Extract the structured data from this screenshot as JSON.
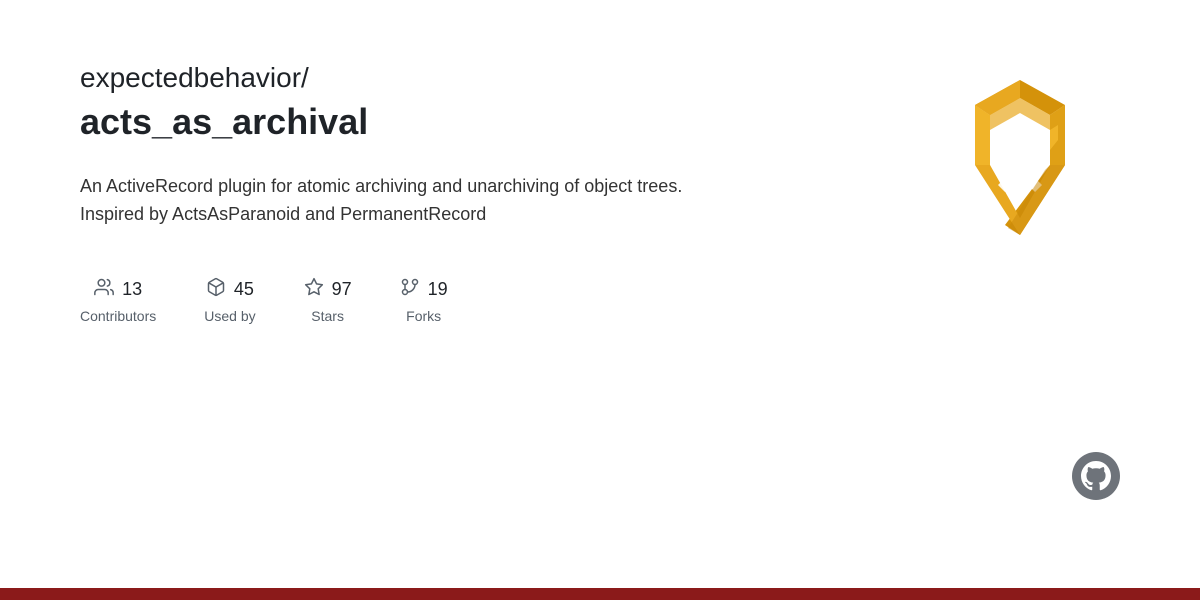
{
  "repo": {
    "owner": "expectedbehavior/",
    "name": "acts_as_archival",
    "description": "An ActiveRecord plugin for atomic archiving and unarchiving of object trees. Inspired by ActsAsParanoid and PermanentRecord"
  },
  "stats": [
    {
      "id": "contributors",
      "number": "13",
      "label": "Contributors",
      "icon": "contributors-icon"
    },
    {
      "id": "used-by",
      "number": "45",
      "label": "Used by",
      "icon": "used-by-icon"
    },
    {
      "id": "stars",
      "number": "97",
      "label": "Stars",
      "icon": "stars-icon"
    },
    {
      "id": "forks",
      "number": "19",
      "label": "Forks",
      "icon": "forks-icon"
    }
  ],
  "bottom_bar_color": "#8b1a1a",
  "github_icon_label": "GitHub"
}
